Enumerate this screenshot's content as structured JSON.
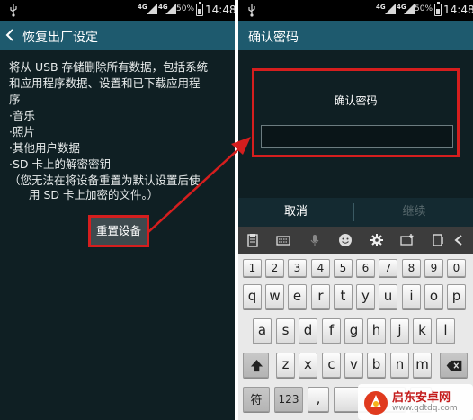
{
  "left_screen": {
    "status": {
      "network": "4G",
      "network2": "4G",
      "battery": "50%",
      "time": "14:48",
      "battery_level": 0.5
    },
    "title": "恢复出厂设定",
    "body": {
      "lines": [
        "将从 USB 存储删除所有数据，包括系统",
        "和应用程序数据、设置和已下载应用程",
        "序",
        "·音乐",
        "·照片",
        "·其他用户数据",
        "·SD 卡上的解密密钥",
        "（您无法在将设备重置为默认设置后使",
        "用 SD 卡上加密的文件。）"
      ]
    },
    "reset_button": "重置设备"
  },
  "right_screen": {
    "status": {
      "network": "4G",
      "network2": "4G",
      "battery": "50%",
      "time": "14:48",
      "battery_level": 0.5
    },
    "title": "确认密码",
    "confirm_label": "确认密码",
    "password_value": "",
    "cancel_label": "取消",
    "continue_label": "继续",
    "keyboard": {
      "toolbar_icons": [
        "clipboard-icon",
        "keyboard-icon",
        "microphone-icon",
        "emoji-icon",
        "settings-icon",
        "keyboard-layout-icon",
        "handwriting-icon",
        "collapse-icon"
      ],
      "number_row": [
        "1",
        "2",
        "3",
        "4",
        "5",
        "6",
        "7",
        "8",
        "9",
        "0"
      ],
      "row1": [
        "q",
        "w",
        "e",
        "r",
        "t",
        "y",
        "u",
        "i",
        "o",
        "p"
      ],
      "row2": [
        "a",
        "s",
        "d",
        "f",
        "g",
        "h",
        "j",
        "k",
        "l"
      ],
      "row3": [
        "z",
        "x",
        "c",
        "v",
        "b",
        "n",
        "m"
      ],
      "bottom": {
        "symbols": "符",
        "numbers": "123",
        "comma": ",",
        "period": "."
      }
    }
  },
  "watermark": {
    "title": "启东安卓网",
    "url": "www.qdtdq.com"
  },
  "colors": {
    "action_bar": "#1e5a6e",
    "highlight": "#d51e1e",
    "background": "#0f1f23"
  }
}
